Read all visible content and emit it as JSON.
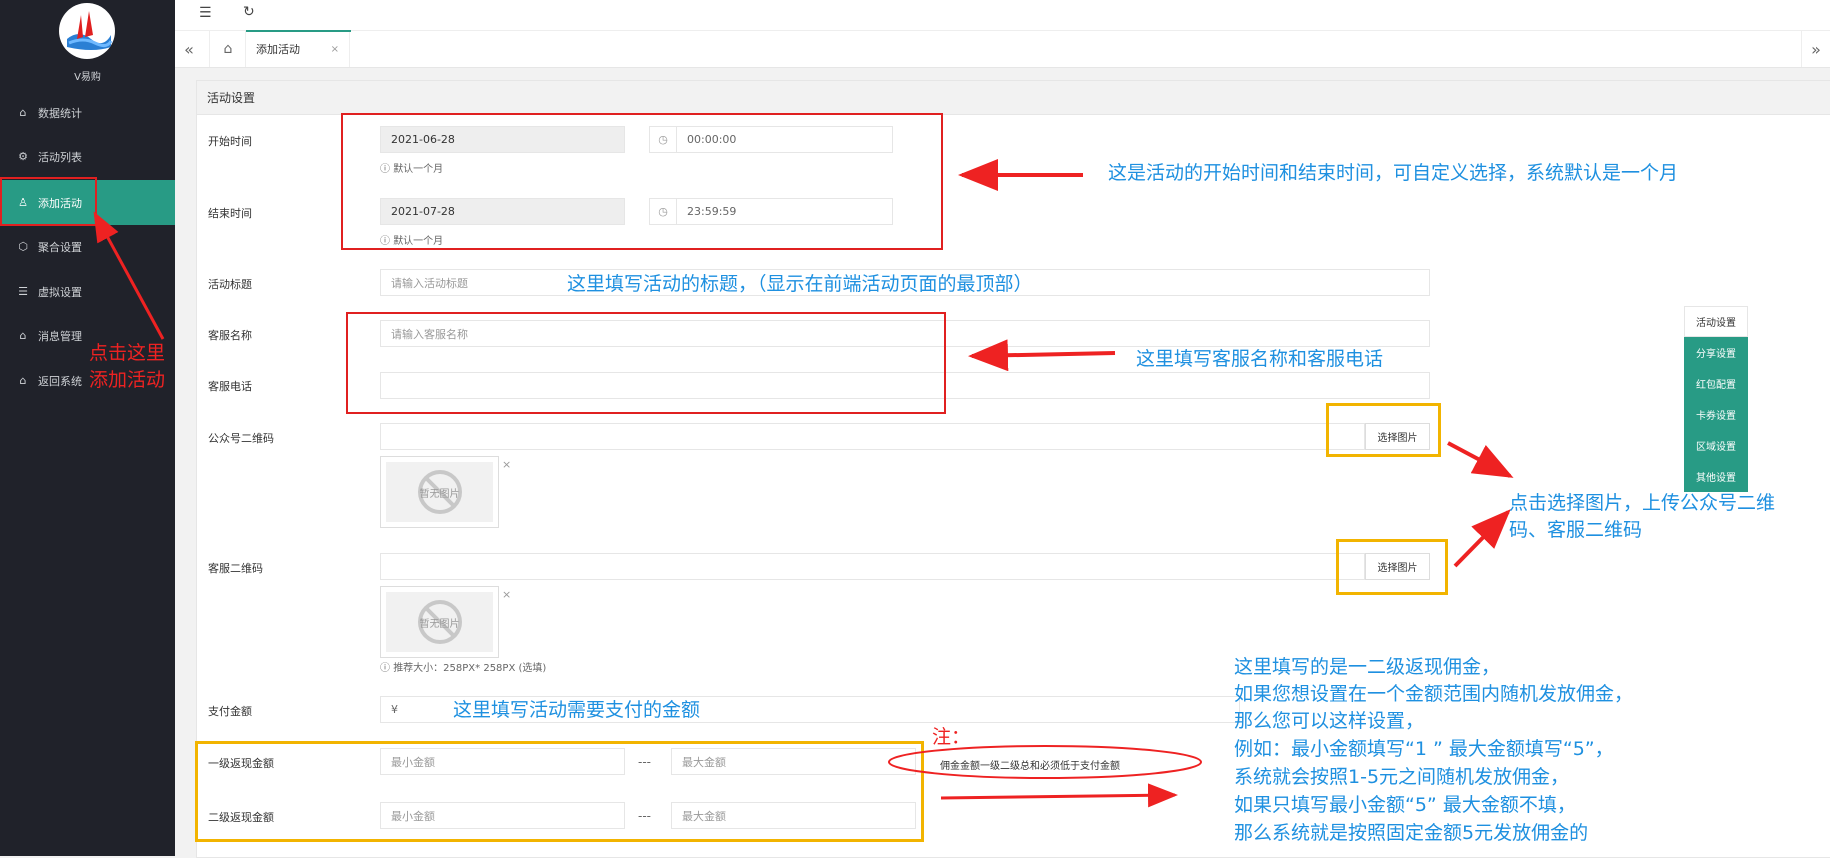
{
  "sidebar": {
    "brand": "V易购",
    "items": [
      {
        "label": "数据统计",
        "icon": "home-icon"
      },
      {
        "label": "活动列表",
        "icon": "gear-icon"
      },
      {
        "label": "添加活动",
        "icon": "user-icon"
      },
      {
        "label": "聚合设置",
        "icon": "cube-icon"
      },
      {
        "label": "虚拟设置",
        "icon": "list-icon"
      },
      {
        "label": "消息管理",
        "icon": "home-icon"
      },
      {
        "label": "返回系统",
        "icon": "home-icon"
      }
    ]
  },
  "header": {
    "menu_icon": "menu-toggle-icon",
    "refresh_icon": "refresh-icon"
  },
  "tabs": {
    "current": "添加活动",
    "close": "×",
    "home_icon": "home-icon"
  },
  "panel": {
    "title": "活动设置"
  },
  "form": {
    "start_time": {
      "label": "开始时间",
      "date": "2021-06-28",
      "time": "00:00:00",
      "hint": "默认一个月"
    },
    "end_time": {
      "label": "结束时间",
      "date": "2021-07-28",
      "time": "23:59:59",
      "hint": "默认一个月"
    },
    "title": {
      "label": "活动标题",
      "placeholder": "请输入活动标题"
    },
    "service_name": {
      "label": "客服名称",
      "placeholder": "请输入客服名称"
    },
    "service_phone": {
      "label": "客服电话",
      "placeholder": ""
    },
    "official_qr": {
      "label": "公众号二维码",
      "button": "选择图片",
      "noimg": "暂无图片"
    },
    "service_qr": {
      "label": "客服二维码",
      "button": "选择图片",
      "noimg": "暂无图片",
      "hint": "推荐大小：258PX* 258PX (选填)"
    },
    "pay_amount": {
      "label": "支付金额",
      "prefix": "¥"
    },
    "level1": {
      "label": "一级返现金额",
      "min": "最小金额",
      "max": "最大金额",
      "sep": "---"
    },
    "level2": {
      "label": "二级返现金额",
      "min": "最小金额",
      "max": "最大金额",
      "sep": "---"
    },
    "note_tag": "佣金金额一级二级总和必须低于支付金额"
  },
  "side_menu": [
    "活动设置",
    "分享设置",
    "红包配置",
    "卡券设置",
    "区域设置",
    "其他设置"
  ],
  "annotations": {
    "time_note": "这是活动的开始时间和结束时间，可自定义选择，系统默认是一个月",
    "title_note": "这里填写活动的标题，（显示在前端活动页面的最顶部）",
    "service_note": "这里填写客服名称和客服电话",
    "sidebar_note_1": "点击这里",
    "sidebar_note_2": "添加活动",
    "image_note_1": "点击选择图片，上传公众号二维",
    "image_note_2": "码、客服二维码",
    "pay_note": "这里填写活动需要支付的金额",
    "note_label": "注：",
    "commission_lines": [
      "这里填写的是一二级返现佣金，",
      "如果您想设置在一个金额范围内随机发放佣金，",
      "那么您可以这样设置，",
      "例如：最小金额填写“1 ” 最大金额填写“5”，",
      "系统就会按照1-5元之间随机发放佣金，",
      "如果只填写最小金额“5” 最大金额不填，",
      "那么系统就是按照固定金额5元发放佣金的"
    ]
  },
  "colors": {
    "accent": "#289b85",
    "sidebar_bg": "#20222a",
    "annotation_blue": "#1e90e0",
    "annotation_red": "#ee2222",
    "highlight_yellow": "#f2b400"
  }
}
